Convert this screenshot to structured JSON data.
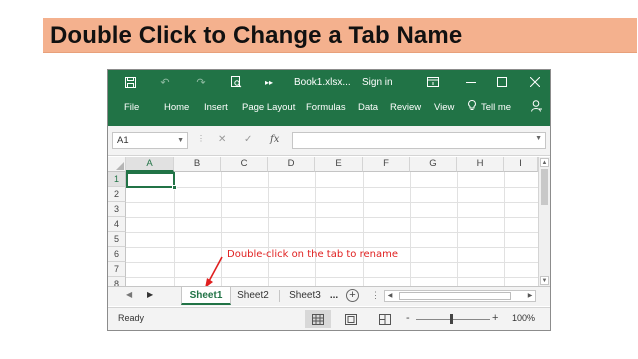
{
  "banner": {
    "title": "Double Click to Change a Tab Name"
  },
  "titlebar": {
    "filename": "Book1.xlsx...",
    "sign_in": "Sign in",
    "more_glyph": "▸▸"
  },
  "ribbon_tabs": [
    "File",
    "Home",
    "Insert",
    "Page Layout",
    "Formulas",
    "Data",
    "Review",
    "View",
    "Tell me"
  ],
  "formula_bar": {
    "name_box": "A1",
    "fx_label": "fx",
    "formula": ""
  },
  "columns": [
    "A",
    "B",
    "C",
    "D",
    "E",
    "F",
    "G",
    "H",
    "I"
  ],
  "rows": [
    "1",
    "2",
    "3",
    "4",
    "5",
    "6",
    "7",
    "8"
  ],
  "selected_cell": "A1",
  "annotation": "Double-click on the tab to rename",
  "sheets": {
    "tabs": [
      "Sheet1",
      "Sheet2",
      "Sheet3"
    ],
    "active": "Sheet1",
    "more": "...",
    "add": "+"
  },
  "status": {
    "text": "Ready",
    "zoom": "100%",
    "zoom_minus": "-",
    "zoom_plus": "+"
  },
  "colors": {
    "excel_green": "#217346",
    "banner": "#f4b18e",
    "annotation": "#e02020"
  },
  "icons": [
    "save-icon",
    "undo-icon",
    "redo-icon",
    "print-preview-icon",
    "ribbon-display-icon",
    "minimize-icon",
    "maximize-icon",
    "close-icon",
    "lightbulb-icon",
    "share-icon"
  ]
}
